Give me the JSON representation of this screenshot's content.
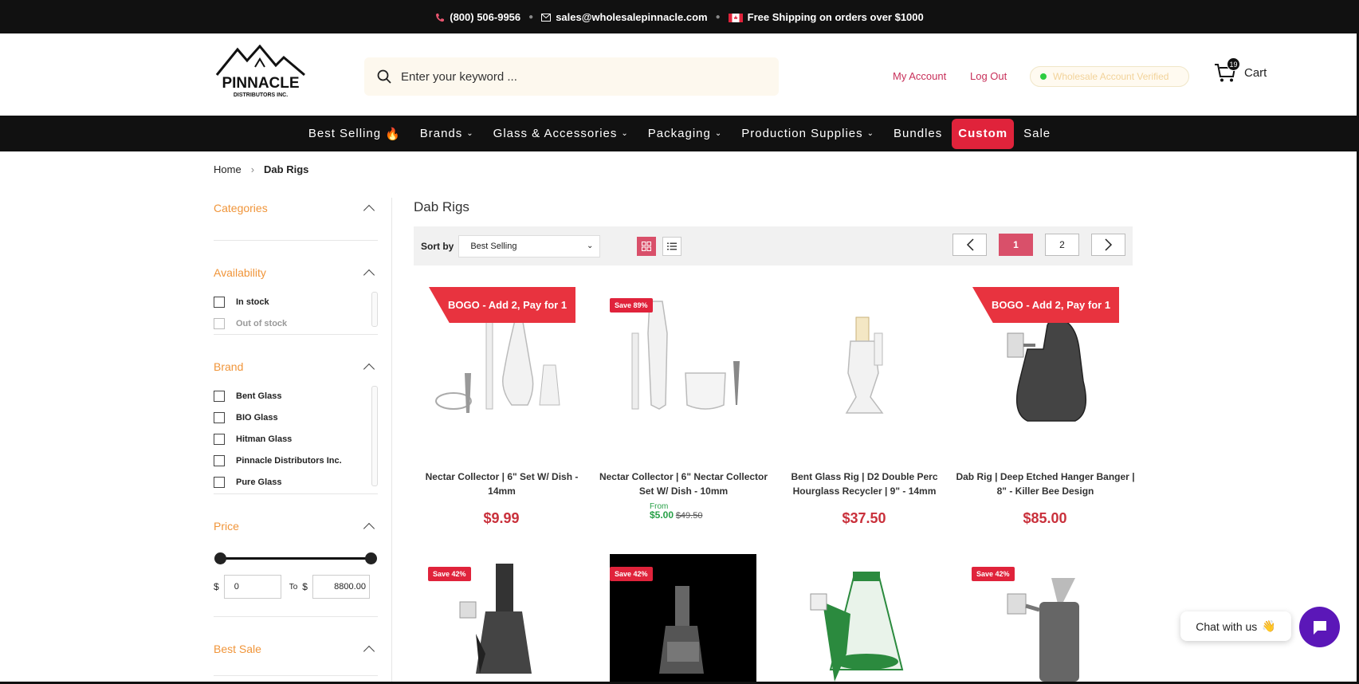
{
  "topbar": {
    "phone": "(800) 506-9956",
    "email": "sales@wholesalepinnacle.com",
    "shipping": "Free Shipping on orders over $1000"
  },
  "header": {
    "logo_text": "PINNACLE",
    "logo_sub": "DISTRIBUTORS INC.",
    "search_placeholder": "Enter your keyword ...",
    "my_account": "My Account",
    "log_out": "Log Out",
    "verified": "Wholesale Account  Verified",
    "cart_label": "Cart",
    "cart_count": "19"
  },
  "nav": [
    {
      "label": "Best Selling",
      "flame": true
    },
    {
      "label": "Brands",
      "chevron": true
    },
    {
      "label": "Glass & Accessories",
      "chevron": true
    },
    {
      "label": "Packaging",
      "chevron": true
    },
    {
      "label": "Production Supplies",
      "chevron": true
    },
    {
      "label": "Bundles"
    },
    {
      "label": "Custom",
      "highlight": true
    },
    {
      "label": "Sale"
    }
  ],
  "breadcrumb": {
    "home": "Home",
    "current": "Dab Rigs"
  },
  "filters": {
    "categories": "Categories",
    "availability": {
      "title": "Availability",
      "options": [
        "In stock",
        "Out of stock"
      ]
    },
    "brand": {
      "title": "Brand",
      "options": [
        "Bent Glass",
        "BIO Glass",
        "Hitman Glass",
        "Pinnacle Distributors Inc.",
        "Pure Glass"
      ]
    },
    "price": {
      "title": "Price",
      "currency": "$",
      "to": "To",
      "min": "0",
      "max": "8800.00"
    },
    "best_sale": "Best Sale"
  },
  "listing": {
    "title": "Dab Rigs",
    "sort_label": "Sort by",
    "sort_value": "Best Selling",
    "pages": [
      "1",
      "2"
    ]
  },
  "products": [
    {
      "name": "Nectar Collector | 6\" Set W/ Dish - 14mm",
      "price": "$9.99",
      "badge": "BOGO - Add 2, Pay for 1"
    },
    {
      "name": "Nectar Collector | 6\" Nectar Collector Set W/ Dish - 10mm",
      "from": "From",
      "price": "$5.00",
      "compare": "$49.50",
      "badge": "Save 89%"
    },
    {
      "name": "Bent Glass Rig | D2 Double Perc Hourglass Recycler | 9\" - 14mm",
      "price": "$37.50"
    },
    {
      "name": "Dab Rig | Deep Etched Hanger Banger | 8\" - Killer Bee Design",
      "price": "$85.00",
      "badge": "BOGO - Add 2, Pay for 1"
    }
  ],
  "row2_badges": [
    "Save 42%",
    "Save 42%",
    "",
    "Save 42%"
  ],
  "chat": {
    "label": "Chat with us"
  },
  "colors": {
    "accent": "#e0233b",
    "filter_title": "#f0953a",
    "price": "#c9303b",
    "chat": "#5b17b8"
  }
}
